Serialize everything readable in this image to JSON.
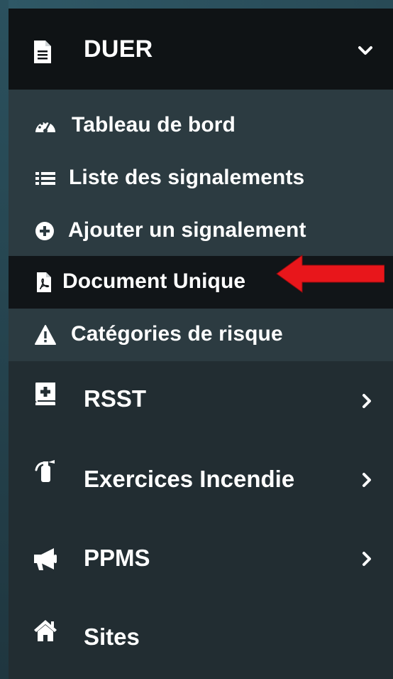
{
  "sidebar": {
    "header": {
      "label": "DUER",
      "icon": "file-icon",
      "expanded": true
    },
    "submenu": [
      {
        "label": "Tableau de bord",
        "icon": "dashboard-icon",
        "active": false
      },
      {
        "label": "Liste des signalements",
        "icon": "list-icon",
        "active": false
      },
      {
        "label": "Ajouter un signalement",
        "icon": "plus-circle-icon",
        "active": false
      },
      {
        "label": "Document Unique",
        "icon": "file-pdf-icon",
        "active": true
      },
      {
        "label": "Catégories de risque",
        "icon": "warning-icon",
        "active": false
      }
    ],
    "items": [
      {
        "label": "RSST",
        "icon": "medical-book-icon",
        "has_children": true
      },
      {
        "label": "Exercices Incendie",
        "icon": "fire-extinguisher-icon",
        "has_children": true
      },
      {
        "label": "PPMS",
        "icon": "bullhorn-icon",
        "has_children": true
      },
      {
        "label": "Sites",
        "icon": "home-icon",
        "has_children": false
      }
    ]
  },
  "annotation": {
    "type": "arrow",
    "color": "#e8161b",
    "points_to": "Document Unique"
  },
  "colors": {
    "sidebar_bg": "#222d32",
    "submenu_bg": "#2c3b41",
    "active_bg": "#111518",
    "header_bg": "#0f1315",
    "text": "#ffffff",
    "arrow": "#e8161b"
  }
}
